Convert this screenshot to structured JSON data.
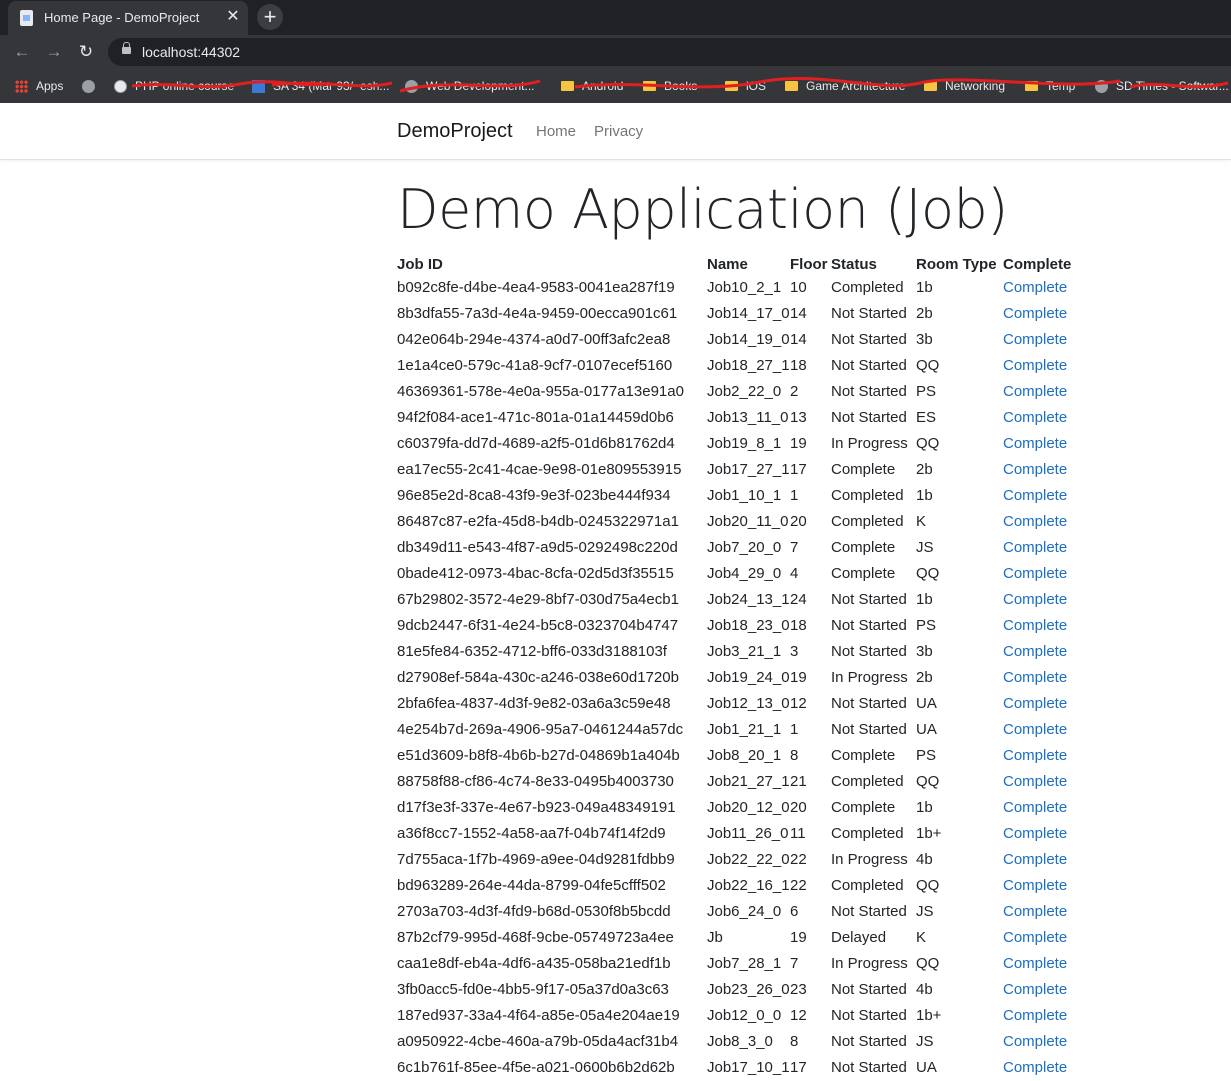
{
  "browser": {
    "tab_title": "Home Page - DemoProject",
    "url": "localhost:44302",
    "bookmarks": [
      {
        "label": "Apps",
        "icon": "apps-grid-icon"
      },
      {
        "label": "",
        "icon": "globe-icon"
      },
      {
        "label": "PHP online course",
        "icon": "site-icon"
      },
      {
        "label": "SA 34 (Mar 93/~esh...",
        "icon": "grid-site-icon"
      },
      {
        "label": "Web Development...",
        "icon": "globe-icon"
      },
      {
        "label": "Android",
        "icon": "folder-icon"
      },
      {
        "label": "Books",
        "icon": "folder-icon"
      },
      {
        "label": "iOS",
        "icon": "folder-icon"
      },
      {
        "label": "Game Architecture",
        "icon": "folder-icon"
      },
      {
        "label": "Networking",
        "icon": "folder-icon"
      },
      {
        "label": "Temp",
        "icon": "folder-icon"
      },
      {
        "label": "SD Times - Softwar...",
        "icon": "globe-icon"
      }
    ]
  },
  "navbar": {
    "brand": "DemoProject",
    "links": [
      "Home",
      "Privacy"
    ]
  },
  "page": {
    "heading": "Demo Application (Job)"
  },
  "table": {
    "headers": [
      "Job ID",
      "Name",
      "Floor",
      "Status",
      "Room Type",
      "Complete"
    ],
    "rows": [
      [
        "b092c8fe-d4be-4ea4-9583-0041ea287f19",
        "Job10_2_1",
        "10",
        "Completed",
        "1b",
        "Complete"
      ],
      [
        "8b3dfa55-7a3d-4e4a-9459-00ecca901c61",
        "Job14_17_0",
        "14",
        "Not Started",
        "2b",
        "Complete"
      ],
      [
        "042e064b-294e-4374-a0d7-00ff3afc2ea8",
        "Job14_19_0",
        "14",
        "Not Started",
        "3b",
        "Complete"
      ],
      [
        "1e1a4ce0-579c-41a8-9cf7-0107ecef5160",
        "Job18_27_1",
        "18",
        "Not Started",
        "QQ",
        "Complete"
      ],
      [
        "46369361-578e-4e0a-955a-0177a13e91a0",
        "Job2_22_0",
        "2",
        "Not Started",
        "PS",
        "Complete"
      ],
      [
        "94f2f084-ace1-471c-801a-01a14459d0b6",
        "Job13_11_0",
        "13",
        "Not Started",
        "ES",
        "Complete"
      ],
      [
        "c60379fa-dd7d-4689-a2f5-01d6b81762d4",
        "Job19_8_1",
        "19",
        "In Progress",
        "QQ",
        "Complete"
      ],
      [
        "ea17ec55-2c41-4cae-9e98-01e809553915",
        "Job17_27_1",
        "17",
        "Complete",
        "2b",
        "Complete"
      ],
      [
        "96e85e2d-8ca8-43f9-9e3f-023be444f934",
        "Job1_10_1",
        "1",
        "Completed",
        "1b",
        "Complete"
      ],
      [
        "86487c87-e2fa-45d8-b4db-0245322971a1",
        "Job20_11_0",
        "20",
        "Completed",
        "K",
        "Complete"
      ],
      [
        "db349d11-e543-4f87-a9d5-0292498c220d",
        "Job7_20_0",
        "7",
        "Complete",
        "JS",
        "Complete"
      ],
      [
        "0bade412-0973-4bac-8cfa-02d5d3f35515",
        "Job4_29_0",
        "4",
        "Complete",
        "QQ",
        "Complete"
      ],
      [
        "67b29802-3572-4e29-8bf7-030d75a4ecb1",
        "Job24_13_1",
        "24",
        "Not Started",
        "1b",
        "Complete"
      ],
      [
        "9dcb2447-6f31-4e24-b5c8-0323704b4747",
        "Job18_23_0",
        "18",
        "Not Started",
        "PS",
        "Complete"
      ],
      [
        "81e5fe84-6352-4712-bff6-033d3188103f",
        "Job3_21_1",
        "3",
        "Not Started",
        "3b",
        "Complete"
      ],
      [
        "d27908ef-584a-430c-a246-038e60d1720b",
        "Job19_24_0",
        "19",
        "In Progress",
        "2b",
        "Complete"
      ],
      [
        "2bfa6fea-4837-4d3f-9e82-03a6a3c59e48",
        "Job12_13_0",
        "12",
        "Not Started",
        "UA",
        "Complete"
      ],
      [
        "4e254b7d-269a-4906-95a7-0461244a57dc",
        "Job1_21_1",
        "1",
        "Not Started",
        "UA",
        "Complete"
      ],
      [
        "e51d3609-b8f8-4b6b-b27d-04869b1a404b",
        "Job8_20_1",
        "8",
        "Complete",
        "PS",
        "Complete"
      ],
      [
        "88758f88-cf86-4c74-8e33-0495b4003730",
        "Job21_27_1",
        "21",
        "Completed",
        "QQ",
        "Complete"
      ],
      [
        "d17f3e3f-337e-4e67-b923-049a48349191",
        "Job20_12_0",
        "20",
        "Complete",
        "1b",
        "Complete"
      ],
      [
        "a36f8cc7-1552-4a58-aa7f-04b74f14f2d9",
        "Job11_26_0",
        "11",
        "Completed",
        "1b+",
        "Complete"
      ],
      [
        "7d755aca-1f7b-4969-a9ee-04d9281fdbb9",
        "Job22_22_0",
        "22",
        "In Progress",
        "4b",
        "Complete"
      ],
      [
        "bd963289-264e-44da-8799-04fe5cfff502",
        "Job22_16_1",
        "22",
        "Completed",
        "QQ",
        "Complete"
      ],
      [
        "2703a703-4d3f-4fd9-b68d-0530f8b5bcdd",
        "Job6_24_0",
        "6",
        "Not Started",
        "JS",
        "Complete"
      ],
      [
        "87b2cf79-995d-468f-9cbe-05749723a4ee",
        "Jb",
        "19",
        "Delayed",
        "K",
        "Complete"
      ],
      [
        "caa1e8df-eb4a-4df6-a435-058ba21edf1b",
        "Job7_28_1",
        "7",
        "In Progress",
        "QQ",
        "Complete"
      ],
      [
        "3fb0acc5-fd0e-4bb5-9f17-05a37d0a3c63",
        "Job23_26_0",
        "23",
        "Not Started",
        "4b",
        "Complete"
      ],
      [
        "187ed937-33a4-4f64-a85e-05a4e204ae19",
        "Job12_0_0",
        "12",
        "Not Started",
        "1b+",
        "Complete"
      ],
      [
        "a0950922-4cbe-460a-a79b-05da4acf31b4",
        "Job8_3_0",
        "8",
        "Not Started",
        "JS",
        "Complete"
      ],
      [
        "6c1b761f-85ee-4f5e-a021-0600b6b2d62b",
        "Job17_10_1",
        "17",
        "Not Started",
        "UA",
        "Complete"
      ]
    ]
  }
}
